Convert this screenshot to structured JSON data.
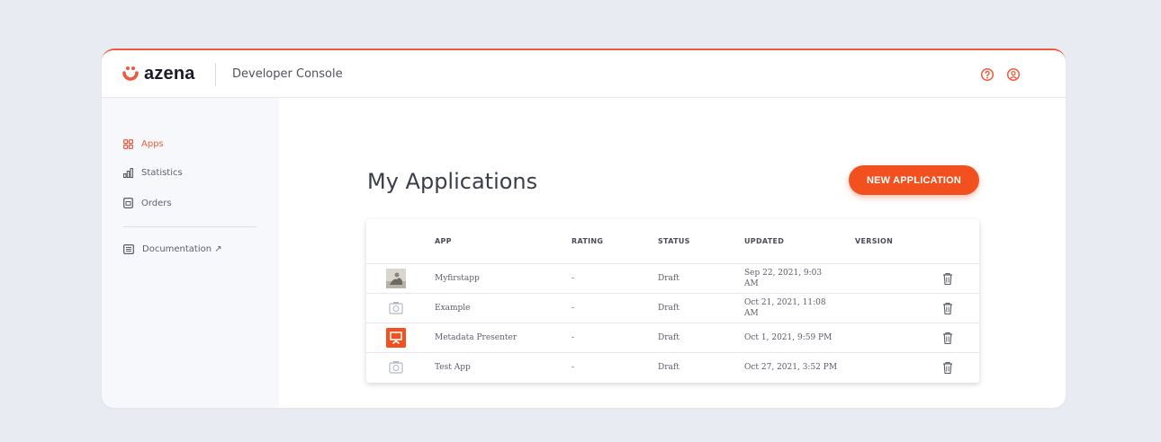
{
  "header": {
    "brand": "azena",
    "console_title": "Developer Console",
    "icons": [
      "help-icon",
      "user-icon"
    ],
    "accent_color": "#f05a3c"
  },
  "sidebar": {
    "items": [
      {
        "label": "Apps",
        "icon": "apps-grid-icon",
        "active": true
      },
      {
        "label": "Statistics",
        "icon": "bar-chart-icon",
        "active": false
      },
      {
        "label": "Orders",
        "icon": "document-icon",
        "active": false
      }
    ],
    "documentation": {
      "label": "Documentation ↗",
      "icon": "book-icon"
    }
  },
  "main": {
    "title": "My Applications",
    "new_button": "NEW APPLICATION",
    "button_color": "#f2511f"
  },
  "table": {
    "columns": {
      "app": "APP",
      "rating": "RATING",
      "status": "STATUS",
      "updated": "UPDATED",
      "version": "VERSION"
    },
    "rows": [
      {
        "app": "Myfirstapp",
        "rating": "-",
        "status": "Draft",
        "updated_line1": "Sep 22, 2021, 9:03",
        "updated_line2": "AM",
        "version": "",
        "icon": "photo-thumbnail"
      },
      {
        "app": "Example",
        "rating": "-",
        "status": "Draft",
        "updated_line1": "Oct 21, 2021, 11:08",
        "updated_line2": "AM",
        "version": "",
        "icon": "camera-placeholder-icon"
      },
      {
        "app": "Metadata Presenter",
        "rating": "-",
        "status": "Draft",
        "updated_line1": "Oct 1, 2021, 9:59 PM",
        "updated_line2": "",
        "version": "",
        "icon": "presenter-icon"
      },
      {
        "app": "Test App",
        "rating": "-",
        "status": "Draft",
        "updated_line1": "Oct 27, 2021, 3:52 PM",
        "updated_line2": "",
        "version": "",
        "icon": "camera-placeholder-icon"
      }
    ]
  }
}
